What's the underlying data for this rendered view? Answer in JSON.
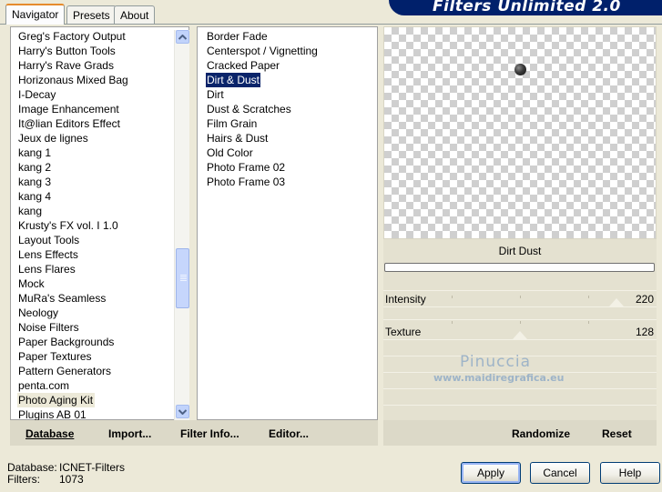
{
  "tabs": [
    "Navigator",
    "Presets",
    "About"
  ],
  "banner_title": "Filters Unlimited 2.0",
  "categories": [
    "Greg's Factory Output",
    "Harry's Button Tools",
    "Harry's Rave Grads",
    "Horizonaus Mixed Bag",
    "I-Decay",
    "Image Enhancement",
    "It@lian Editors Effect",
    "Jeux de lignes",
    "kang 1",
    "kang 2",
    "kang 3",
    "kang 4",
    "kang",
    "Krusty's FX vol. I 1.0",
    "Layout Tools",
    "Lens Effects",
    "Lens Flares",
    "Mock",
    "MuRa's Seamless",
    "Neology",
    "Noise Filters",
    "Paper Backgrounds",
    "Paper Textures",
    "Pattern Generators",
    "penta.com",
    "Photo Aging Kit",
    "Plugins AB 01"
  ],
  "selected_category": "Photo Aging Kit",
  "filters": [
    "Border Fade",
    "Centerspot / Vignetting",
    "Cracked Paper",
    "Dirt & Dust",
    "Dirt",
    "Dust & Scratches",
    "Film Grain",
    "Hairs & Dust",
    "Old Color",
    "Photo Frame 02",
    "Photo Frame 03"
  ],
  "selected_filter": "Dirt & Dust",
  "preview": {
    "filter_title": "Dirt  Dust",
    "progress": 0
  },
  "sliders": [
    {
      "label": "Intensity",
      "value": "220",
      "level": 220
    },
    {
      "label": "Texture",
      "value": "128",
      "level": 128
    }
  ],
  "watermark": {
    "name": "Pinuccia",
    "url": "www.maidiregrafica.eu"
  },
  "left_buttons": {
    "database": "Database",
    "import": "Import...",
    "filter_info": "Filter Info...",
    "editor": "Editor..."
  },
  "right_buttons": {
    "randomize": "Randomize",
    "reset": "Reset"
  },
  "status": {
    "database_label": "Database:",
    "database_value": "ICNET-Filters",
    "filters_label": "Filters:",
    "filters_value": "1073"
  },
  "dialog_buttons": {
    "apply": "Apply",
    "cancel": "Cancel",
    "help": "Help"
  }
}
